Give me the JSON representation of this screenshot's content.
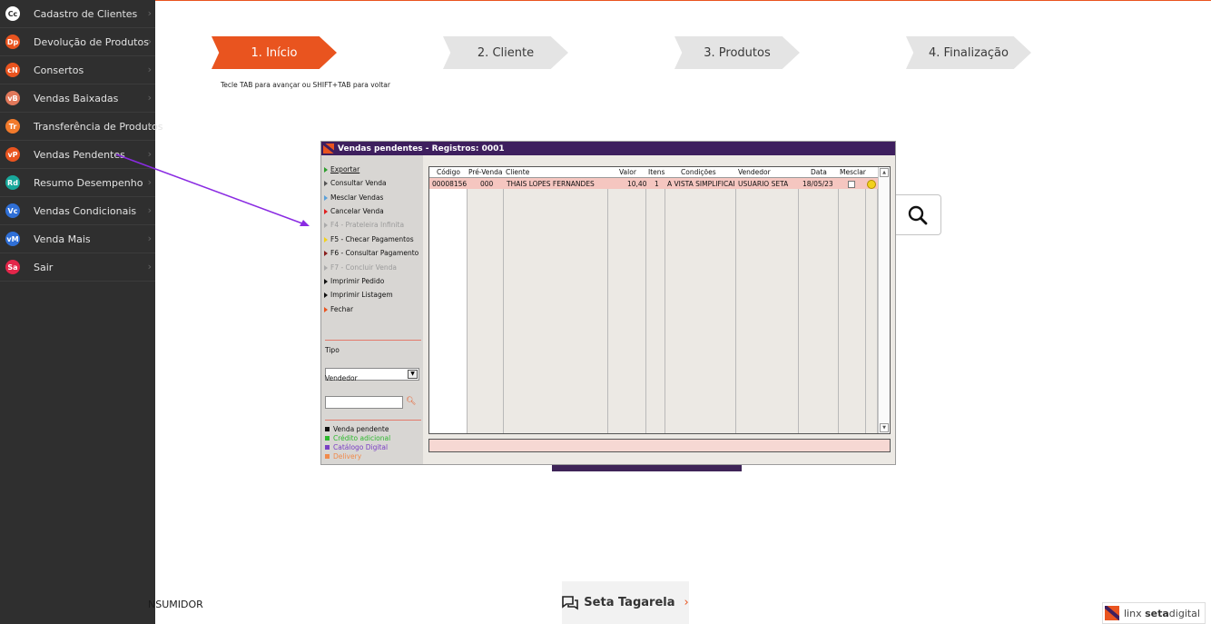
{
  "colors": {
    "accent": "#e9541f",
    "brand_purple": "#3e1f5e",
    "sidebar_bg": "#2f2f2f",
    "row_highlight": "#f5c6c0"
  },
  "sidebar": {
    "items": [
      {
        "badge": "Cc",
        "badge_color": "#ffffff",
        "badge_text_color": "#2f2f2f",
        "label": "Cadastro de Clientes"
      },
      {
        "badge": "Dp",
        "badge_color": "#e9541f",
        "label": "Devolução de Produtos"
      },
      {
        "badge": "cN",
        "badge_color": "#e9541f",
        "label": "Consertos"
      },
      {
        "badge": "vB",
        "badge_color": "#e1785a",
        "label": "Vendas Baixadas"
      },
      {
        "badge": "Tr",
        "badge_color": "#f27a2b",
        "label": "Transferência de Produtos"
      },
      {
        "badge": "vP",
        "badge_color": "#e9541f",
        "label": "Vendas Pendentes"
      },
      {
        "badge": "Rd",
        "badge_color": "#18a89b",
        "label": "Resumo Desempenho"
      },
      {
        "badge": "Vc",
        "badge_color": "#2f6fd6",
        "label": "Vendas Condicionais"
      },
      {
        "badge": "vM",
        "badge_color": "#2f6fd6",
        "label": "Venda Mais"
      },
      {
        "badge": "Sa",
        "badge_color": "#e3264a",
        "label": "Sair"
      }
    ],
    "footer_text": "NSUMIDOR"
  },
  "steps": [
    {
      "label": "1. Início",
      "active": true
    },
    {
      "label": "2. Cliente",
      "active": false
    },
    {
      "label": "3. Produtos",
      "active": false
    },
    {
      "label": "4. Finalização",
      "active": false
    }
  ],
  "hint": "Tecle TAB para avançar ou SHIFT+TAB para voltar",
  "dialog": {
    "title": "Vendas pendentes - Registros: 0001",
    "menu": [
      {
        "label": "Exportar",
        "color": "#2e9e2e",
        "enabled": true
      },
      {
        "label": "Consultar Venda",
        "color": "#555555",
        "enabled": true
      },
      {
        "label": "Mesclar Vendas",
        "color": "#5aa0d8",
        "enabled": true
      },
      {
        "label": "Cancelar Venda",
        "color": "#e02020",
        "enabled": true
      },
      {
        "label": "F4 - Prateleira Infinita",
        "color": "#aaaaaa",
        "enabled": false
      },
      {
        "label": "F5 - Checar Pagamentos",
        "color": "#f2d11c",
        "enabled": true
      },
      {
        "label": "F6 - Consultar Pagamento",
        "color": "#8a1f1f",
        "enabled": true
      },
      {
        "label": "F7 - Concluir Venda",
        "color": "#aaaaaa",
        "enabled": false
      },
      {
        "label": "Imprimir Pedido",
        "color": "#111111",
        "enabled": true
      },
      {
        "label": "Imprimir Listagem",
        "color": "#111111",
        "enabled": true
      },
      {
        "label": "Fechar",
        "color": "#e9541f",
        "enabled": true
      }
    ],
    "tipo_label": "Tipo",
    "tipo_value": "",
    "vendedor_label": "Vendedor",
    "vendedor_value": "",
    "legend": [
      {
        "label": "Venda pendente",
        "color": "#111111"
      },
      {
        "label": "Crédito adicional",
        "color": "#2eb82e"
      },
      {
        "label": "Catálogo Digital",
        "color": "#7a3fc4"
      },
      {
        "label": "Delivery",
        "color": "#f08a4b"
      }
    ],
    "grid": {
      "columns": [
        "Código",
        "Pré-Venda",
        "Cliente",
        "Valor",
        "Itens",
        "Condições",
        "Vendedor",
        "Data",
        "Mesclar"
      ],
      "rows": [
        {
          "codigo": "00008156",
          "pre_venda": "000",
          "cliente": "THAIS LOPES FERNANDES",
          "valor": "10,40",
          "itens": "1",
          "condicoes": "A VISTA SIMPLIFICAI",
          "vendedor": "USUARIO SETA",
          "data": "18/05/23",
          "mesclar": false
        }
      ]
    }
  },
  "bottom_card": {
    "label": "Seta Tagarela",
    "chevron": "›"
  },
  "brand": {
    "prefix": "linx ",
    "bold": "seta",
    "suffix": "digital"
  }
}
